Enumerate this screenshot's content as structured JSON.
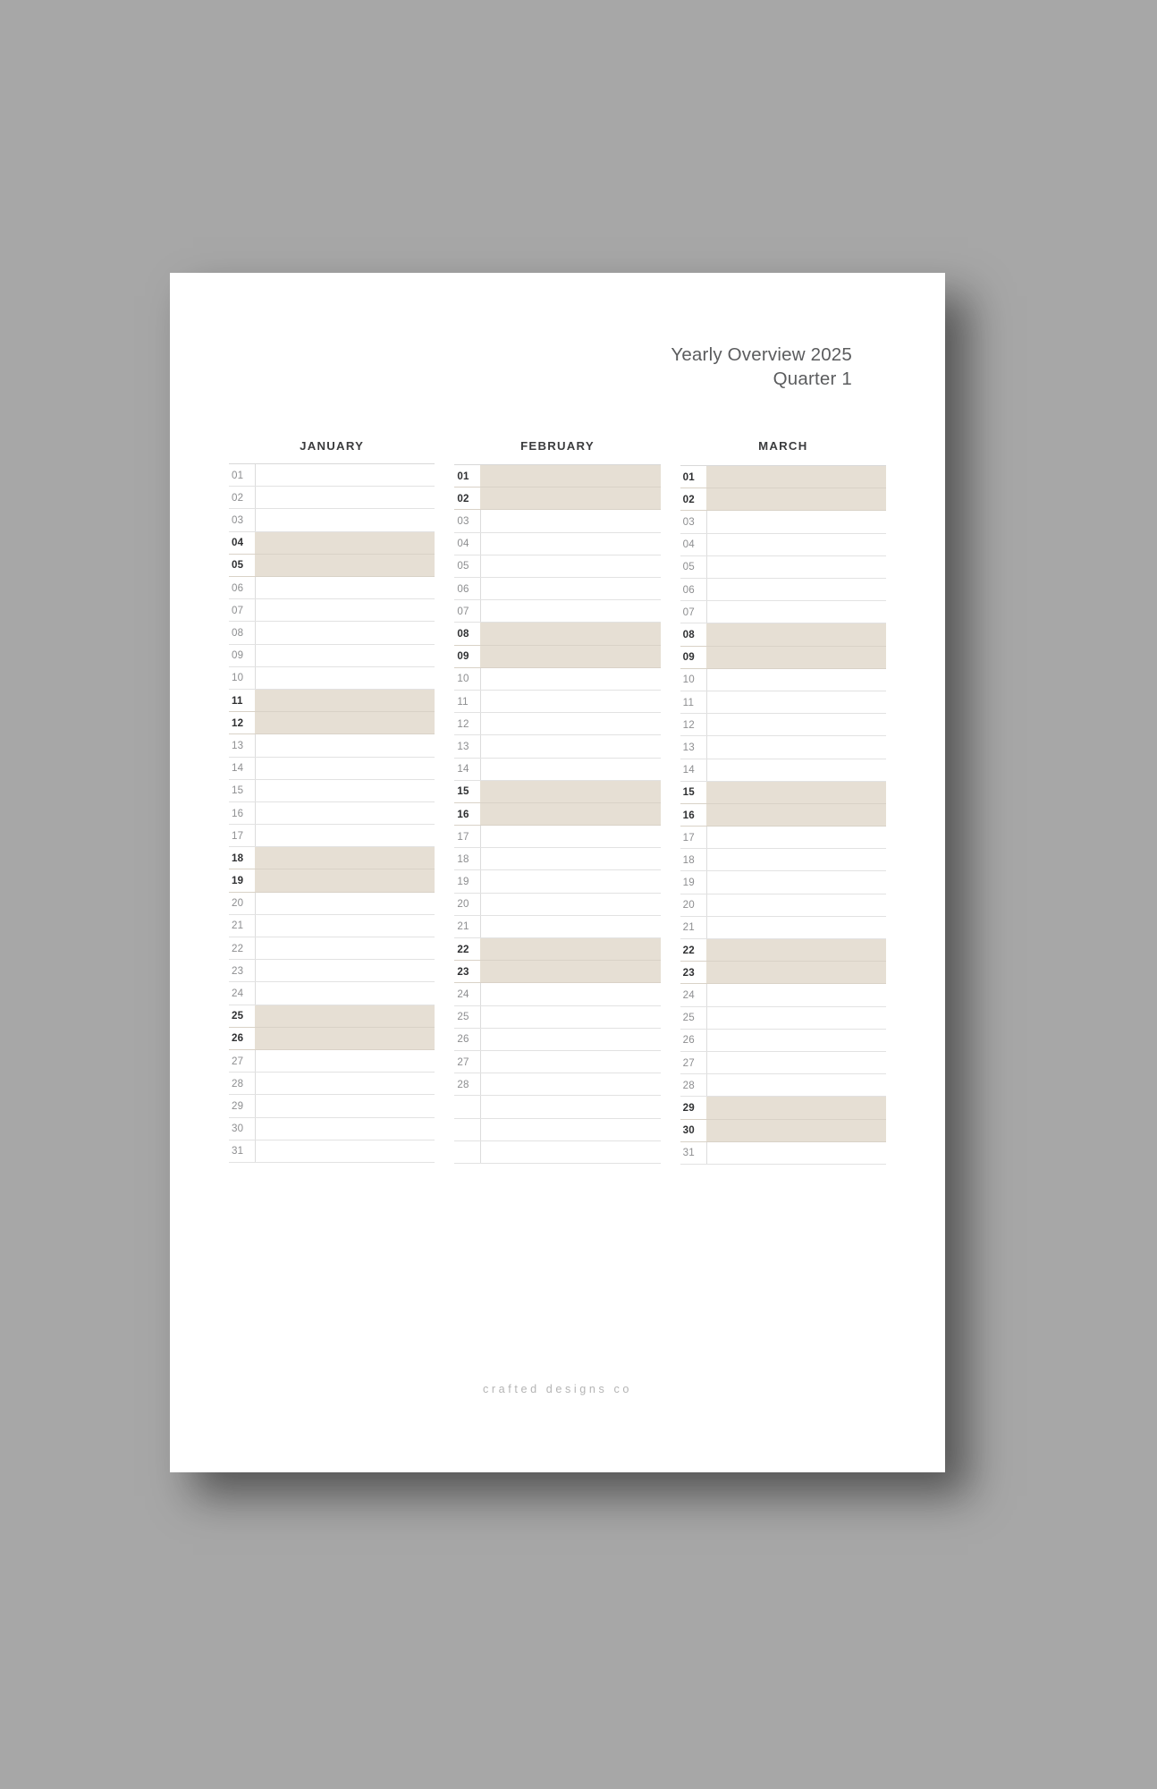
{
  "header": {
    "title": "Yearly Overview 2025",
    "subtitle": "Quarter 1"
  },
  "footer": {
    "brand": "crafted designs co"
  },
  "colors": {
    "page_background": "#ffffff",
    "canvas_background": "#a7a7a7",
    "highlight_fill": "#e6dfd4",
    "rule_line": "#e2e2e2",
    "day_number": "#8d8e90",
    "day_number_highlight": "#2f3032",
    "title_text": "#5b5c5e",
    "month_title_text": "#3b3c3e",
    "footer_text": "#b4b4b4"
  },
  "months": [
    {
      "name": "JANUARY",
      "days": [
        {
          "label": "01",
          "highlight": false
        },
        {
          "label": "02",
          "highlight": false
        },
        {
          "label": "03",
          "highlight": false
        },
        {
          "label": "04",
          "highlight": true
        },
        {
          "label": "05",
          "highlight": true
        },
        {
          "label": "06",
          "highlight": false
        },
        {
          "label": "07",
          "highlight": false
        },
        {
          "label": "08",
          "highlight": false
        },
        {
          "label": "09",
          "highlight": false
        },
        {
          "label": "10",
          "highlight": false
        },
        {
          "label": "11",
          "highlight": true
        },
        {
          "label": "12",
          "highlight": true
        },
        {
          "label": "13",
          "highlight": false
        },
        {
          "label": "14",
          "highlight": false
        },
        {
          "label": "15",
          "highlight": false
        },
        {
          "label": "16",
          "highlight": false
        },
        {
          "label": "17",
          "highlight": false
        },
        {
          "label": "18",
          "highlight": true
        },
        {
          "label": "19",
          "highlight": true
        },
        {
          "label": "20",
          "highlight": false
        },
        {
          "label": "21",
          "highlight": false
        },
        {
          "label": "22",
          "highlight": false
        },
        {
          "label": "23",
          "highlight": false
        },
        {
          "label": "24",
          "highlight": false
        },
        {
          "label": "25",
          "highlight": true
        },
        {
          "label": "26",
          "highlight": true
        },
        {
          "label": "27",
          "highlight": false
        },
        {
          "label": "28",
          "highlight": false
        },
        {
          "label": "29",
          "highlight": false
        },
        {
          "label": "30",
          "highlight": false
        },
        {
          "label": "31",
          "highlight": false
        }
      ]
    },
    {
      "name": "FEBRUARY",
      "days": [
        {
          "label": "01",
          "highlight": true
        },
        {
          "label": "02",
          "highlight": true
        },
        {
          "label": "03",
          "highlight": false
        },
        {
          "label": "04",
          "highlight": false
        },
        {
          "label": "05",
          "highlight": false
        },
        {
          "label": "06",
          "highlight": false
        },
        {
          "label": "07",
          "highlight": false
        },
        {
          "label": "08",
          "highlight": true
        },
        {
          "label": "09",
          "highlight": true
        },
        {
          "label": "10",
          "highlight": false
        },
        {
          "label": "11",
          "highlight": false
        },
        {
          "label": "12",
          "highlight": false
        },
        {
          "label": "13",
          "highlight": false
        },
        {
          "label": "14",
          "highlight": false
        },
        {
          "label": "15",
          "highlight": true
        },
        {
          "label": "16",
          "highlight": true
        },
        {
          "label": "17",
          "highlight": false
        },
        {
          "label": "18",
          "highlight": false
        },
        {
          "label": "19",
          "highlight": false
        },
        {
          "label": "20",
          "highlight": false
        },
        {
          "label": "21",
          "highlight": false
        },
        {
          "label": "22",
          "highlight": true
        },
        {
          "label": "23",
          "highlight": true
        },
        {
          "label": "24",
          "highlight": false
        },
        {
          "label": "25",
          "highlight": false
        },
        {
          "label": "26",
          "highlight": false
        },
        {
          "label": "27",
          "highlight": false
        },
        {
          "label": "28",
          "highlight": false
        },
        {
          "label": "",
          "highlight": false
        },
        {
          "label": "",
          "highlight": false
        },
        {
          "label": "",
          "highlight": false
        }
      ]
    },
    {
      "name": "MARCH",
      "days": [
        {
          "label": "01",
          "highlight": true
        },
        {
          "label": "02",
          "highlight": true
        },
        {
          "label": "03",
          "highlight": false
        },
        {
          "label": "04",
          "highlight": false
        },
        {
          "label": "05",
          "highlight": false
        },
        {
          "label": "06",
          "highlight": false
        },
        {
          "label": "07",
          "highlight": false
        },
        {
          "label": "08",
          "highlight": true
        },
        {
          "label": "09",
          "highlight": true
        },
        {
          "label": "10",
          "highlight": false
        },
        {
          "label": "11",
          "highlight": false
        },
        {
          "label": "12",
          "highlight": false
        },
        {
          "label": "13",
          "highlight": false
        },
        {
          "label": "14",
          "highlight": false
        },
        {
          "label": "15",
          "highlight": true
        },
        {
          "label": "16",
          "highlight": true
        },
        {
          "label": "17",
          "highlight": false
        },
        {
          "label": "18",
          "highlight": false
        },
        {
          "label": "19",
          "highlight": false
        },
        {
          "label": "20",
          "highlight": false
        },
        {
          "label": "21",
          "highlight": false
        },
        {
          "label": "22",
          "highlight": true
        },
        {
          "label": "23",
          "highlight": true
        },
        {
          "label": "24",
          "highlight": false
        },
        {
          "label": "25",
          "highlight": false
        },
        {
          "label": "26",
          "highlight": false
        },
        {
          "label": "27",
          "highlight": false
        },
        {
          "label": "28",
          "highlight": false
        },
        {
          "label": "29",
          "highlight": true
        },
        {
          "label": "30",
          "highlight": true
        },
        {
          "label": "31",
          "highlight": false
        }
      ]
    }
  ]
}
